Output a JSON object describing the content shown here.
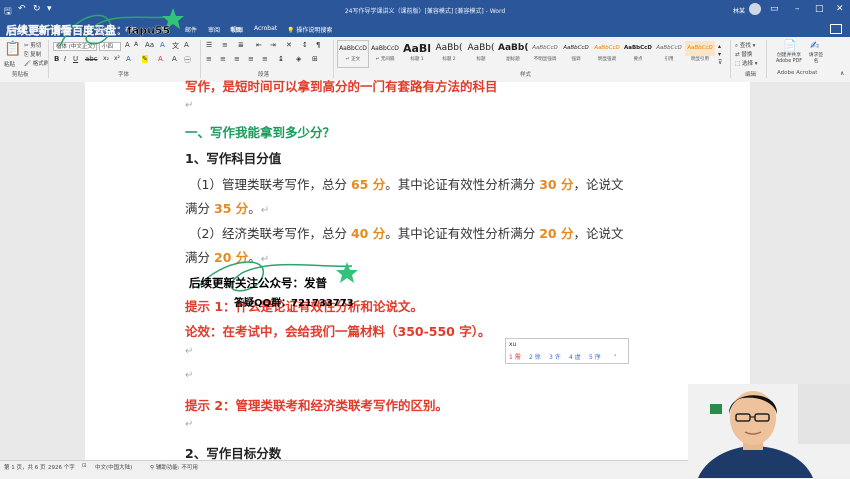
{
  "titlebar": {
    "doc_title": "24写作导学课讲义（课前版）[兼容模式] [兼容模式] - Word",
    "user": "林某"
  },
  "tabs": [
    "文件",
    "开始",
    "插入",
    "设计",
    "布局",
    "引用",
    "邮件",
    "审阅",
    "视图",
    "帮助",
    "Acrobat"
  ],
  "tell_me": "操作说明搜索",
  "ribbon": {
    "clipboard": {
      "paste": "粘贴",
      "cut": "剪切",
      "copy": "复制",
      "format_painter": "格式刷",
      "label": "剪贴板"
    },
    "font": {
      "name": "楷体 (中文正文)",
      "size": "小四",
      "label": "字体"
    },
    "paragraph": {
      "label": "段落"
    },
    "styles": {
      "label": "样式",
      "items": [
        {
          "sample": "AaBbCcD",
          "name": "↵ 正文"
        },
        {
          "sample": "AaBbCcD",
          "name": "↵ 无间隔"
        },
        {
          "sample": "AaBl",
          "name": "标题 1"
        },
        {
          "sample": "AaBb(",
          "name": "标题 2"
        },
        {
          "sample": "AaBb(",
          "name": "标题"
        },
        {
          "sample": "AaBb(",
          "name": "副标题"
        },
        {
          "sample": "AaBbCcD",
          "name": "不明显强调"
        },
        {
          "sample": "AaBbCcD",
          "name": "强调"
        },
        {
          "sample": "AaBbCcD",
          "name": "明显强调"
        },
        {
          "sample": "AaBbCcD",
          "name": "要点"
        },
        {
          "sample": "AaBbCcD",
          "name": "引用"
        },
        {
          "sample": "AaBbCcD",
          "name": "明显引用"
        },
        {
          "sample": "AaBbCcD",
          "name": "不明显参考"
        }
      ]
    },
    "editing": {
      "find": "查找",
      "replace": "替换",
      "select": "选择",
      "label": "编辑"
    },
    "acrobat": {
      "create_share": "创建并共享 Adobe PDF",
      "request_sign": "请求签名",
      "label": "Adobe Acrobat"
    }
  },
  "document": {
    "line_top": "写作，是短时间可以拿到高分的一门有套路有方法的科目",
    "section1": "一、写作我能拿到多少分？",
    "sub1": "1、写作科目分值",
    "p1_a": "（1）管理类联考写作，总分",
    "p1_n1": "65 分",
    "p1_b": "。其中论证有效性分析满分",
    "p1_n2": "30 分",
    "p1_c": "，论说文",
    "p1_d": "满分",
    "p1_n3": "35 分",
    "p1_e": "。",
    "p2_a": "（2）经济类联考写作，总分",
    "p2_n1": "40 分",
    "p2_b": "。其中论证有效性分析满分",
    "p2_n2": "20 分",
    "p2_c": "，论说文",
    "p2_d": "满分",
    "p2_n3": "20 分",
    "p2_e": "。",
    "tip1": "提示 1：什么是论证有效性分析和论说文。",
    "lunxiao": "论效：在考试中，会给我们一篇材料（350-550 字）。",
    "tip2": "提示 2：管理类联考和经济类联考写作的区别。",
    "sub2": "2、写作目标分数"
  },
  "ime": {
    "input": "xu",
    "candidates": [
      "1 需",
      "2 徐",
      "3 许",
      "4 虚",
      "5 序"
    ]
  },
  "overlays": {
    "top": "后续更新请看百度云盘：fapu55",
    "mid": "后续更新关注公众号：发普",
    "qq": "答疑QQ群：721733773"
  },
  "status": {
    "page": "第 1 页，共 6 页",
    "words": "2926 个字",
    "lang": "中文(中国大陆)",
    "access": "辅助功能: 不可用"
  }
}
